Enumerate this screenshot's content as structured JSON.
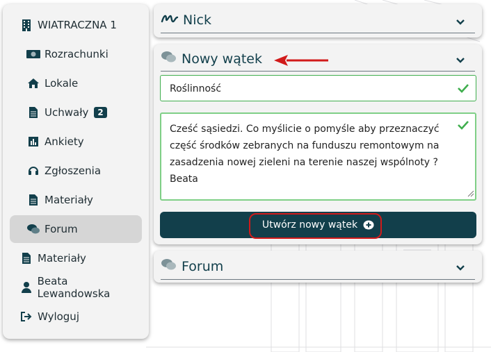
{
  "sidebar": {
    "items": [
      {
        "label": "WIATRACZNA 1",
        "icon": "building-icon"
      },
      {
        "label": "Rozrachunki",
        "icon": "money-icon"
      },
      {
        "label": "Lokale",
        "icon": "home-icon"
      },
      {
        "label": "Uchwały",
        "icon": "document-icon",
        "badge": "2"
      },
      {
        "label": "Ankiety",
        "icon": "bar-chart-icon"
      },
      {
        "label": "Zgłoszenia",
        "icon": "headset-icon"
      },
      {
        "label": "Materiały",
        "icon": "document-icon"
      },
      {
        "label": "Forum",
        "icon": "comments-icon",
        "active": true
      },
      {
        "label": "Materiały",
        "icon": "document-icon"
      },
      {
        "label": "Beata Lewandowska",
        "icon": "user-icon"
      },
      {
        "label": "Wyloguj",
        "icon": "logout-icon"
      }
    ]
  },
  "nick_card": {
    "title": "Nick"
  },
  "new_thread_card": {
    "title": "Nowy wątek",
    "subject_value": "Roślinność",
    "body_value": "Cześć sąsiedzi. Co myślicie o pomyśle aby przeznaczyć część środków zebranych na funduszu remontowym na zasadzenia nowej zieleni na terenie naszej wspólnoty ? Beata",
    "submit_label": "Utwórz nowy wątek"
  },
  "forum_card": {
    "title": "Forum"
  },
  "colors": {
    "primary": "#123f4b",
    "valid": "#3fae4d",
    "annotation": "#d11a1a"
  }
}
